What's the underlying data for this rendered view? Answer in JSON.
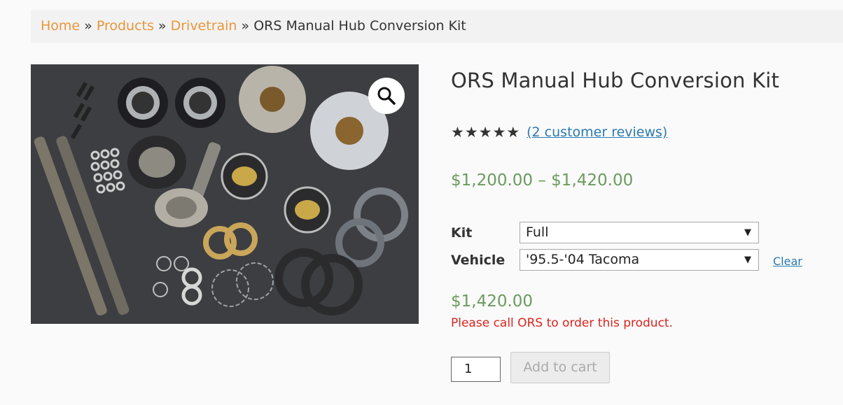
{
  "breadcrumb": {
    "items": [
      "Home",
      "Products",
      "Drivetrain"
    ],
    "separator": "»",
    "current": "ORS Manual Hub Conversion Kit"
  },
  "gallery": {
    "zoom_icon": "magnifier-icon"
  },
  "product": {
    "title": "ORS Manual Hub Conversion Kit",
    "rating_stars": 5,
    "reviews_link": "(2 customer reviews)",
    "price_range": "$1,200.00 – $1,420.00",
    "variations": [
      {
        "label": "Kit",
        "selected": "Full"
      },
      {
        "label": "Vehicle",
        "selected": "'95.5-'04 Tacoma"
      }
    ],
    "clear_label": "Clear",
    "variation_price": "$1,420.00",
    "notice": "Please call ORS to order this product.",
    "quantity": "1",
    "add_to_cart_label": "Add to cart"
  },
  "colors": {
    "breadcrumb_link": "#e8963a",
    "price": "#6b9b5e",
    "notice": "#d9251d",
    "link": "#2a7ab0"
  }
}
